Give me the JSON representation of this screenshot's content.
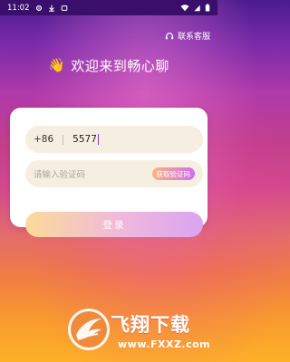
{
  "status_bar": {
    "time": "11:02",
    "left_icons": [
      "gear-icon",
      "download-icon",
      "notification-icon"
    ],
    "right_icons": [
      "wifi-icon",
      "signal-icon",
      "battery-icon"
    ]
  },
  "header": {
    "service_label": "联系客服",
    "service_icon": "headset-icon"
  },
  "welcome": {
    "emoji": "👋",
    "title": "欢迎来到畅心聊"
  },
  "form": {
    "country_code": "+86",
    "phone_value": "5577",
    "code_placeholder": "请输入验证码",
    "get_code_label": "获取验证码",
    "login_label": "登录"
  },
  "watermark": {
    "title": "飞翔下载",
    "domain": "www.FXXZ.com"
  },
  "colors": {
    "accent": "#d26cf0",
    "field_background": "#f6efe1",
    "status_bar": "#3a0f6b"
  }
}
